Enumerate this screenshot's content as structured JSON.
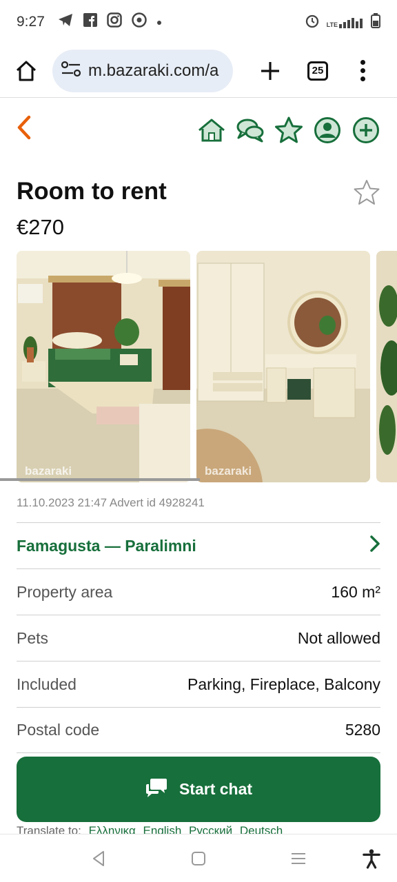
{
  "status_bar": {
    "time": "9:27",
    "notification_icons": [
      "telegram-icon",
      "facebook-icon",
      "instagram-icon",
      "chrome-icon",
      "dot-icon"
    ],
    "right_icons": [
      "alarm-icon",
      "lte-signal-icon",
      "battery-icon"
    ],
    "lte_label": "LTE"
  },
  "browser": {
    "url": "m.bazaraki.com/a",
    "tab_count": "25"
  },
  "site_nav": {
    "icons": [
      "home-icon",
      "chat-icon",
      "star-icon",
      "profile-icon",
      "add-icon"
    ],
    "accent_color": "#176f3b",
    "back_color": "#e8600a"
  },
  "listing": {
    "title": "Room to rent",
    "price": "€270",
    "photo_watermark": "bazaraki",
    "meta": "11.10.2023 21:47 Advert id 4928241",
    "location": "Famagusta — Paralimni",
    "details": [
      {
        "label": "Property area",
        "value": "160 m²"
      },
      {
        "label": "Pets",
        "value": "Not allowed"
      },
      {
        "label": "Included",
        "value": "Parking, Fireplace, Balcony"
      },
      {
        "label": "Postal code",
        "value": "5280"
      }
    ]
  },
  "chat_button": {
    "label": "Start chat"
  },
  "translate": {
    "label": "Translate to:",
    "languages": [
      "Ελληνικα",
      "English",
      "Русский",
      "Deutsch"
    ]
  }
}
